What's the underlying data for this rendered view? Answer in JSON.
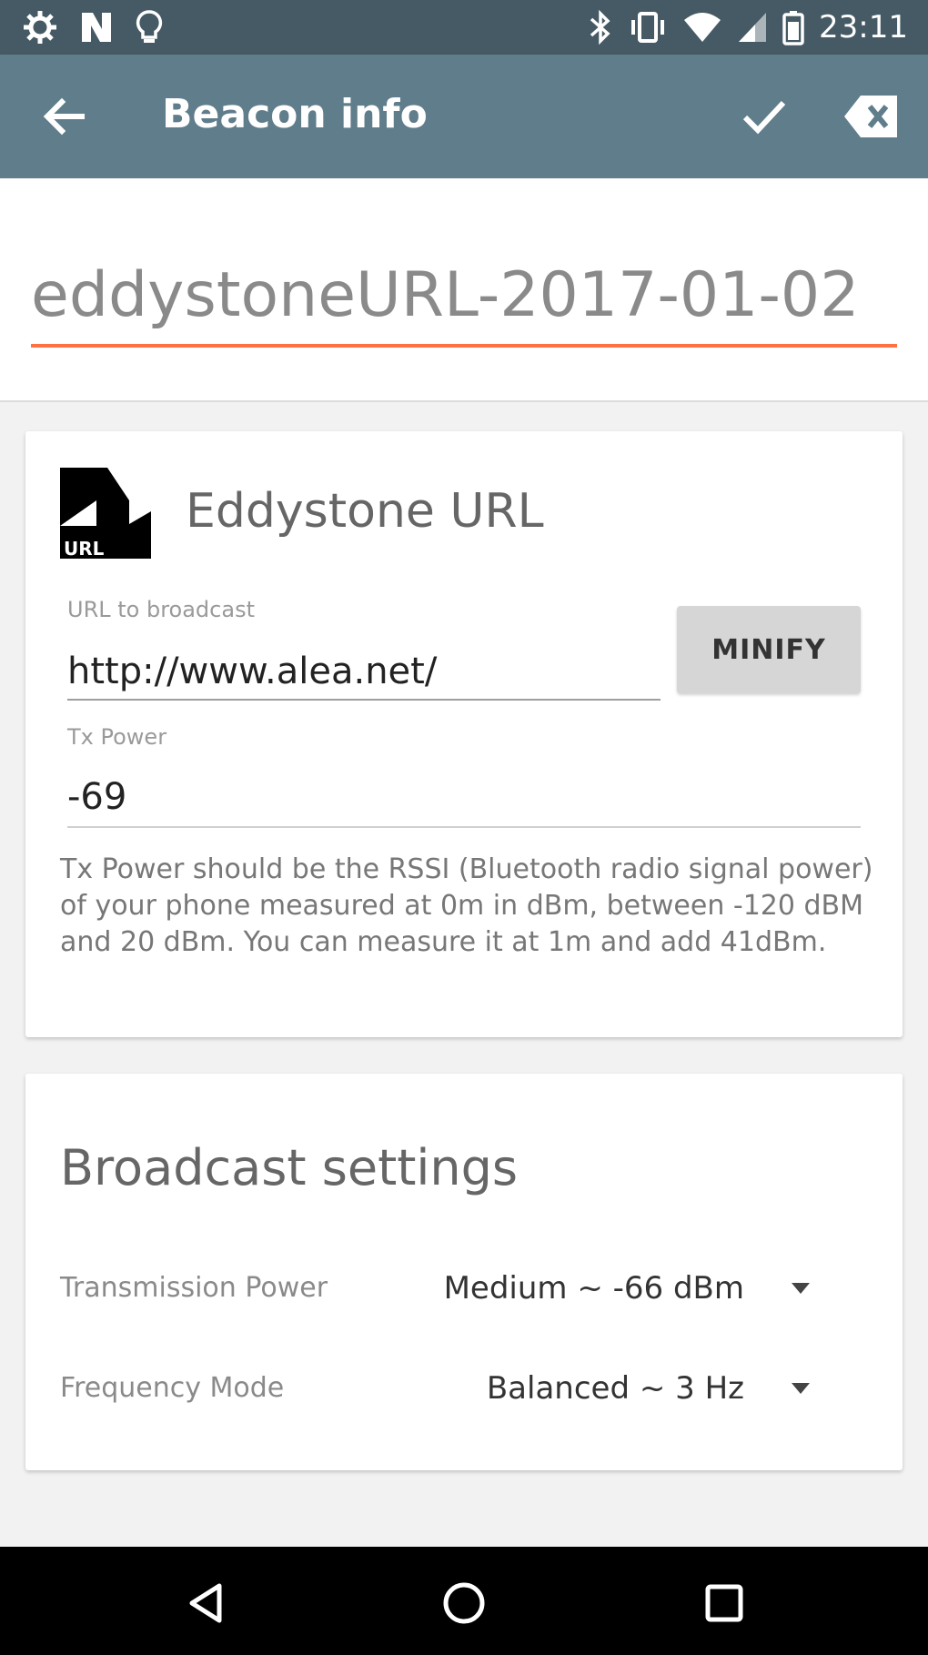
{
  "status_bar": {
    "time": "23:11",
    "left_icons": [
      "settings-gear-icon",
      "notification-n-icon",
      "bulb-icon"
    ],
    "right_icons": [
      "bluetooth-icon",
      "vibrate-icon",
      "wifi-icon",
      "signal-icon",
      "battery-icon"
    ]
  },
  "app_bar": {
    "title": "Beacon info",
    "background": "#607d8b"
  },
  "beacon_name": {
    "value": "eddystoneURL-2017-01-02",
    "accent": "#ff7043"
  },
  "eddystone_card": {
    "logo_text": "URL",
    "title": "Eddystone URL",
    "url_label": "URL to broadcast",
    "url_value": "http://www.alea.net/",
    "minify_label": "MINIFY",
    "tx_label": "Tx Power",
    "tx_value": "-69",
    "help_text": "Tx Power should be the RSSI (Bluetooth radio signal power) of your phone measured at 0m in dBm, between -120 dBM and 20 dBm. You can measure it at 1m and add 41dBm."
  },
  "broadcast_card": {
    "title": "Broadcast settings",
    "transmission_power_label": "Transmission Power",
    "transmission_power_value": "Medium ~ -66 dBm",
    "frequency_mode_label": "Frequency Mode",
    "frequency_mode_value": "Balanced ~ 3 Hz"
  },
  "nav_bar": {
    "icons": [
      "nav-back-icon",
      "nav-home-icon",
      "nav-recents-icon"
    ]
  }
}
